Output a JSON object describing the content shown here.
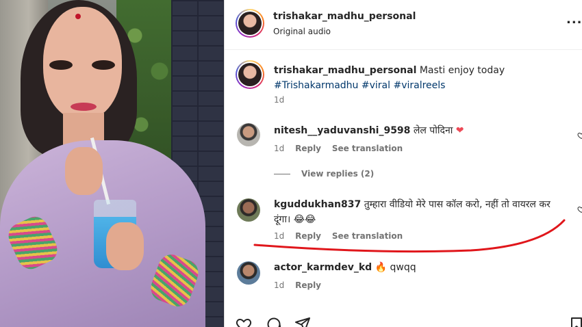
{
  "post": {
    "author": "trishakar_madhu_personal",
    "audio_label": "Original audio",
    "caption_text": "Masti enjoy today",
    "caption_tags": [
      "#Trishakarmadhu",
      "#viral",
      "#viralreels"
    ],
    "caption_time": "1d"
  },
  "comments": [
    {
      "username": "nitesh__yaduvanshi_9598",
      "text": "लेल पोदिना",
      "emoji": "❤",
      "time": "1d",
      "reply_label": "Reply",
      "translate_label": "See translation",
      "view_replies": "View replies (2)"
    },
    {
      "username": "kguddukhan837",
      "text": "तुम्हारा वीडियो मेरे पास कॉल करो, नहीं तो वायरल कर दूंगा।",
      "emoji": "😂😂",
      "time": "1d",
      "reply_label": "Reply",
      "translate_label": "See translation"
    },
    {
      "username": "actor_karmdev_kd",
      "emoji": "🔥",
      "text": "qwqq",
      "time": "1d",
      "reply_label": "Reply"
    }
  ],
  "icons": {
    "more": "more-options-icon",
    "like": "heart-icon",
    "comment": "comment-icon",
    "share": "send-icon",
    "save": "bookmark-icon"
  },
  "colors": {
    "hashtag": "#00376b",
    "meta_gray": "#737373",
    "annotation_red": "#e0161b",
    "heart_red": "#ed4956"
  }
}
